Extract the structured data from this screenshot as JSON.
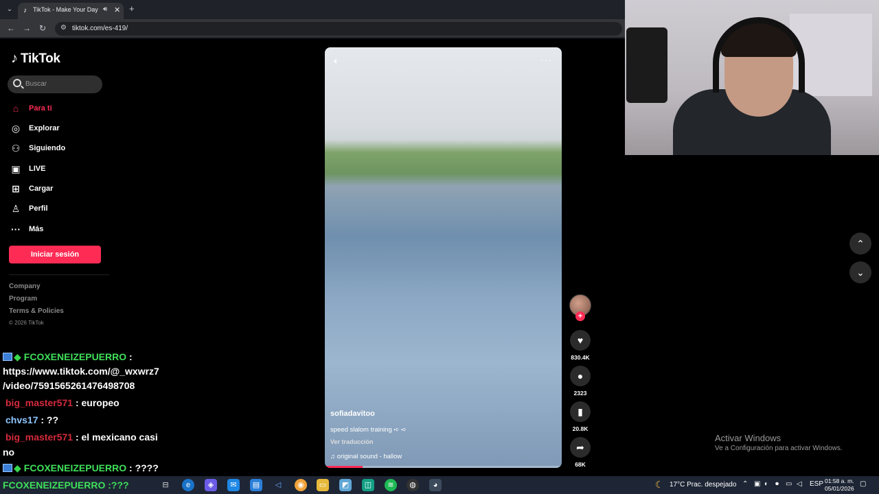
{
  "browser": {
    "tab_title": "TikTok - Make Your Day",
    "url": "tiktok.com/es-419/"
  },
  "tiktok": {
    "logo": "TikTok",
    "search_placeholder": "Buscar",
    "nav": [
      {
        "label": "Para ti",
        "icon": "home-icon"
      },
      {
        "label": "Explorar",
        "icon": "compass-icon"
      },
      {
        "label": "Siguiendo",
        "icon": "user-follow-icon"
      },
      {
        "label": "LIVE",
        "icon": "live-icon"
      },
      {
        "label": "Cargar",
        "icon": "upload-icon"
      },
      {
        "label": "Perfil",
        "icon": "profile-icon"
      },
      {
        "label": "Más",
        "icon": "more-icon"
      }
    ],
    "login_button": "Iniciar sesión",
    "footer": [
      "Company",
      "Program",
      "Terms & Policies"
    ],
    "copyright": "© 2026 TikTok"
  },
  "video": {
    "username": "sofiadavitoo",
    "description": "speed slalom training ➪ ➪",
    "translate": "Ver traducción",
    "sound": "original sound - hallow",
    "progress": 0.16,
    "likes": "830.4K",
    "comments": "2323",
    "saves": "20.8K",
    "shares": "68K"
  },
  "chat": [
    {
      "user": "FCOXENEIZEPUERRO",
      "sep": " :",
      "color": "green"
    },
    {
      "text": "https://www.tiktok.com/@_wxwrz7"
    },
    {
      "text": "/video/7591565261476498708"
    },
    {
      "user": "big_master571",
      "message": " : europeo",
      "color": "red"
    },
    {
      "user": "chvs17",
      "message": " : ??",
      "color": "blue"
    },
    {
      "user": "big_master571",
      "message": " : el mexicano casi",
      "color": "red"
    },
    {
      "text": "no"
    },
    {
      "user": "FCOXENEIZEPUERRO",
      "message": " : ????",
      "color": "green"
    }
  ],
  "taskbar": {
    "chat_overlay": "FCOXENEIZEPUERRO :???",
    "weather": "17°C  Prac. despejado",
    "lang": "ESP",
    "time": "01:58 a. m.",
    "date": "05/01/2026"
  },
  "windows": {
    "activate_title": "Activar Windows",
    "activate_sub": "Ve a Configuración para activar Windows."
  }
}
